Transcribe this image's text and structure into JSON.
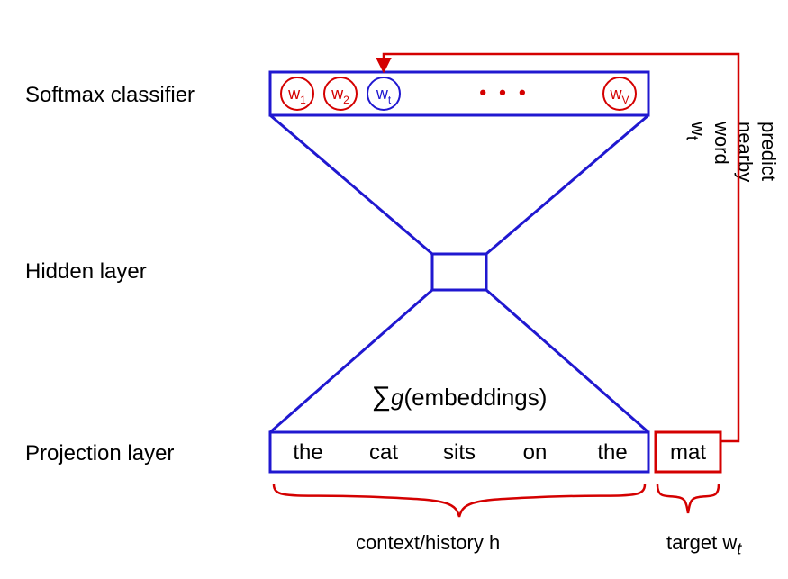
{
  "labels": {
    "softmax": "Softmax classifier",
    "hidden": "Hidden layer",
    "projection": "Projection layer",
    "context": "context/history h",
    "target": "target w",
    "target_sub": "t",
    "predict_prefix": "predict nearby word w",
    "predict_sub": "t",
    "embedding_prefix": "g",
    "embedding_rest": "(embeddings)"
  },
  "softmax_tokens": {
    "w1": {
      "base": "w",
      "sub": "1"
    },
    "w2": {
      "base": "w",
      "sub": "2"
    },
    "wt": {
      "base": "w",
      "sub": "t"
    },
    "ellipsis": "• • •",
    "wv": {
      "base": "w",
      "sub": "V"
    }
  },
  "projection_words": {
    "p0": "the",
    "p1": "cat",
    "p2": "sits",
    "p3": "on",
    "p4": "the",
    "target": "mat"
  },
  "colors": {
    "blue": "#2018d0",
    "red": "#d40000"
  }
}
